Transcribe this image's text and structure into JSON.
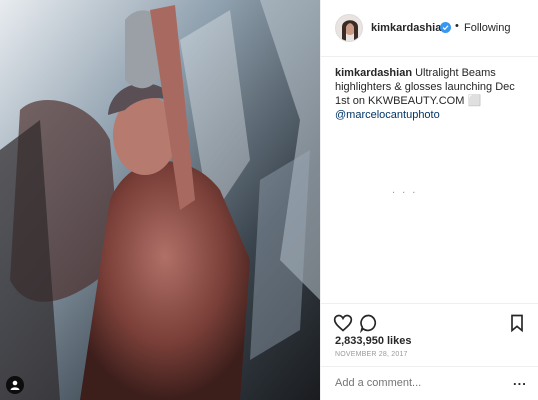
{
  "post": {
    "image_alt": "glitter body portrait",
    "user_tag_icon": "person-tag-icon"
  },
  "header": {
    "username": "kimkardashian",
    "verified_icon": "verified-badge-icon",
    "separator": "•",
    "follow_label": "Following"
  },
  "caption": {
    "username": "kimkardashian",
    "text": "Ultralight Beams highlighters & glosses launching Dec 1st on KKWBEAUTY.COM",
    "glyph": "⬜",
    "mention": "@marcelocantuphoto"
  },
  "comments_loading": ". . .",
  "actions": {
    "like_icon": "heart-icon",
    "comment_icon": "comment-icon",
    "save_icon": "bookmark-icon"
  },
  "likes": "2,833,950 likes",
  "date": "NOVEMBER 28, 2017",
  "comment_box": {
    "placeholder": "Add a comment...",
    "more_label": "..."
  }
}
